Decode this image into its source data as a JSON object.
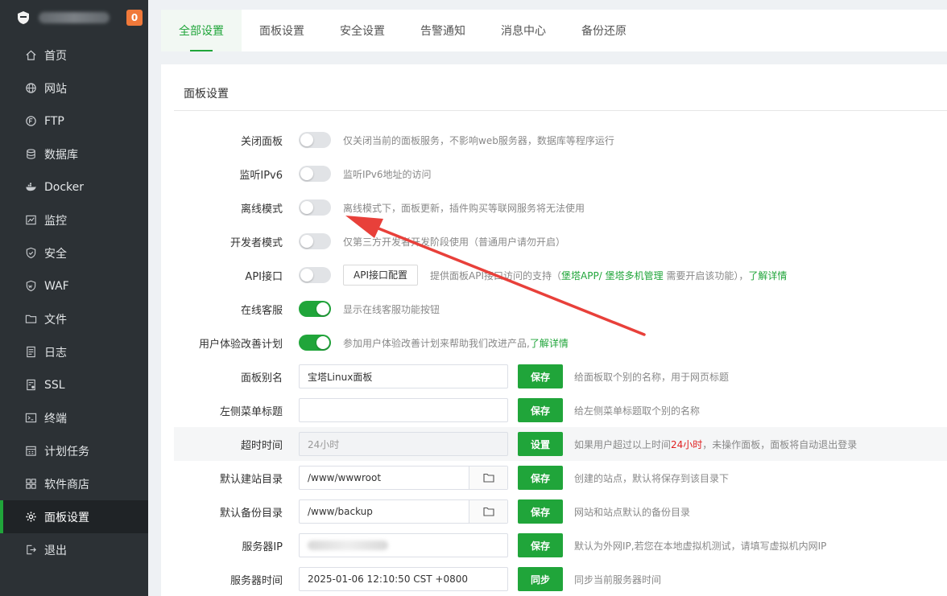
{
  "header": {
    "notification_count": "0"
  },
  "sidebar": {
    "items": [
      {
        "label": "首页",
        "icon": "home-icon"
      },
      {
        "label": "网站",
        "icon": "globe-icon"
      },
      {
        "label": "FTP",
        "icon": "ftp-icon"
      },
      {
        "label": "数据库",
        "icon": "database-icon"
      },
      {
        "label": "Docker",
        "icon": "docker-icon"
      },
      {
        "label": "监控",
        "icon": "monitor-icon"
      },
      {
        "label": "安全",
        "icon": "shield-icon"
      },
      {
        "label": "WAF",
        "icon": "waf-icon"
      },
      {
        "label": "文件",
        "icon": "folder-icon"
      },
      {
        "label": "日志",
        "icon": "log-icon"
      },
      {
        "label": "SSL",
        "icon": "ssl-icon"
      },
      {
        "label": "终端",
        "icon": "terminal-icon"
      },
      {
        "label": "计划任务",
        "icon": "calendar-icon"
      },
      {
        "label": "软件商店",
        "icon": "apps-icon"
      },
      {
        "label": "面板设置",
        "icon": "gear-icon",
        "active": true
      },
      {
        "label": "退出",
        "icon": "logout-icon"
      }
    ]
  },
  "tabs": [
    {
      "label": "全部设置",
      "active": true
    },
    {
      "label": "面板设置"
    },
    {
      "label": "安全设置"
    },
    {
      "label": "告警通知"
    },
    {
      "label": "消息中心"
    },
    {
      "label": "备份还原"
    }
  ],
  "section": {
    "title": "面板设置"
  },
  "settings": {
    "close_panel": {
      "label": "关闭面板",
      "on": false,
      "desc": "仅关闭当前的面板服务，不影响web服务器，数据库等程序运行"
    },
    "listen_ipv6": {
      "label": "监听IPv6",
      "on": false,
      "desc": "监听IPv6地址的访问"
    },
    "offline_mode": {
      "label": "离线模式",
      "on": false,
      "desc": "离线模式下，面板更新，插件购买等联网服务将无法使用"
    },
    "dev_mode": {
      "label": "开发者模式",
      "on": false,
      "desc": "仅第三方开发者开发阶段使用（普通用户请勿开启）"
    },
    "api": {
      "label": "API接口",
      "on": false,
      "button": "API接口配置",
      "desc_prefix": "提供面板API接口访问的支持（",
      "link1": "堡塔APP/",
      "link2": "堡塔多机管理",
      "desc_mid": " 需要开启该功能），",
      "link3": "了解详情"
    },
    "online_service": {
      "label": "在线客服",
      "on": true,
      "desc": "显示在线客服功能按钮"
    },
    "ux_plan": {
      "label": "用户体验改善计划",
      "on": true,
      "desc": "参加用户体验改善计划来帮助我们改进产品,",
      "link": "了解详情"
    },
    "panel_alias": {
      "label": "面板别名",
      "value": "宝塔Linux面板",
      "button": "保存",
      "desc": "给面板取个别的名称，用于网页标题"
    },
    "menu_title": {
      "label": "左侧菜单标题",
      "value": "",
      "button": "保存",
      "desc": "给左侧菜单标题取个别的名称"
    },
    "timeout": {
      "label": "超时时间",
      "value": "24小时",
      "button": "设置",
      "desc_prefix": "如果用户超过以上时间",
      "desc_highlight": "24小时",
      "desc_suffix": "，未操作面板，面板将自动退出登录"
    },
    "default_site_dir": {
      "label": "默认建站目录",
      "value": "/www/wwwroot",
      "button": "保存",
      "desc": "创建的站点，默认将保存到该目录下"
    },
    "default_backup_dir": {
      "label": "默认备份目录",
      "value": "/www/backup",
      "button": "保存",
      "desc": "网站和站点默认的备份目录"
    },
    "server_ip": {
      "label": "服务器IP",
      "button": "保存",
      "desc": "默认为外网IP,若您在本地虚拟机测试，请填写虚拟机内网IP"
    },
    "server_time": {
      "label": "服务器时间",
      "value": "2025-01-06 12:10:50 CST +0800",
      "button": "同步",
      "desc": "同步当前服务器时间"
    }
  },
  "colors": {
    "accent": "#20a53a",
    "sidebar_bg": "#2c3135",
    "badge": "#f0793a",
    "annotation_arrow": "#e8403a"
  }
}
